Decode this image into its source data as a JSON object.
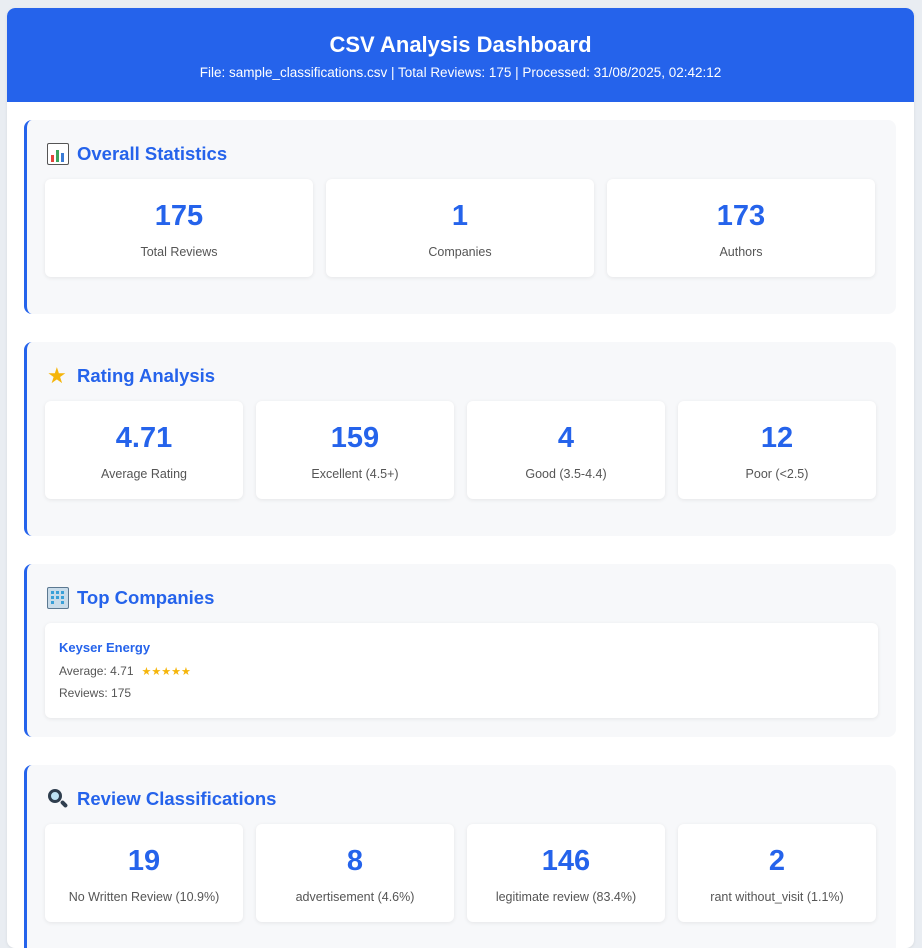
{
  "header": {
    "title": "CSV Analysis Dashboard",
    "subtitle": "File: sample_classifications.csv | Total Reviews: 175 | Processed: 31/08/2025, 02:42:12"
  },
  "overall": {
    "title": "Overall Statistics",
    "icon": "bar-chart-icon",
    "stats": [
      {
        "value": "175",
        "label": "Total Reviews"
      },
      {
        "value": "1",
        "label": "Companies"
      },
      {
        "value": "173",
        "label": "Authors"
      }
    ]
  },
  "rating": {
    "title": "Rating Analysis",
    "icon": "star-icon",
    "stats": [
      {
        "value": "4.71",
        "label": "Average Rating"
      },
      {
        "value": "159",
        "label": "Excellent (4.5+)"
      },
      {
        "value": "4",
        "label": "Good (3.5-4.4)"
      },
      {
        "value": "12",
        "label": "Poor (<2.5)"
      }
    ]
  },
  "companies": {
    "title": "Top Companies",
    "icon": "building-icon",
    "items": [
      {
        "name": "Keyser Energy",
        "average": "Average: 4.71",
        "stars": "★★★★★",
        "reviews": "Reviews: 175"
      }
    ]
  },
  "classifications": {
    "title": "Review Classifications",
    "icon": "magnifying-glass-icon",
    "stats": [
      {
        "value": "19",
        "label": "No Written Review (10.9%)"
      },
      {
        "value": "8",
        "label": "advertisement (4.6%)"
      },
      {
        "value": "146",
        "label": "legitimate review (83.4%)"
      },
      {
        "value": "2",
        "label": "rant without_visit (1.1%)"
      }
    ]
  },
  "colors": {
    "accent": "#2563eb",
    "star": "#f5b50a",
    "section_bg": "#f7f8fa"
  }
}
